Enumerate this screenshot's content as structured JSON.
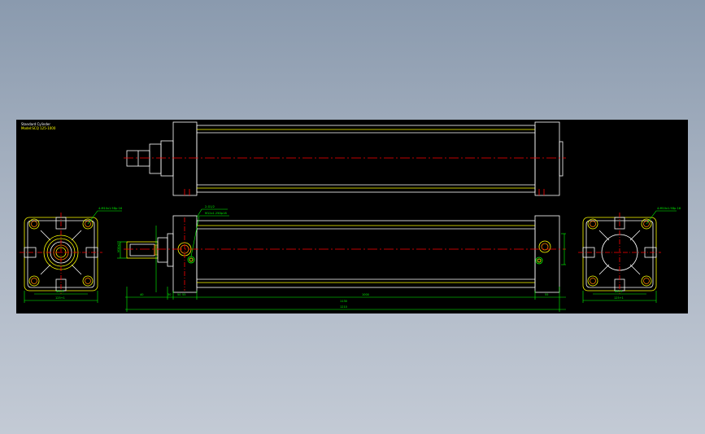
{
  "title_block": {
    "line1": "Standard Cylinder",
    "line2": "Model:SCQ 125-1000"
  },
  "annotations": {
    "left_leader": "4-M10x1.5Dp 16",
    "right_leader": "4-M10x1.5Dp 16",
    "port_note_1": "2-G1/2",
    "port_note_2": "M12x1.25Dp18",
    "rod_dim": "M30x2",
    "left_width_1": "Φ105",
    "left_width_2": "125+1",
    "right_width_1": "Φ105",
    "right_width_2": "125+1"
  },
  "dimensions": {
    "d1": "40",
    "d2": "30",
    "d3": "50",
    "d4": "55",
    "stroke": "1000",
    "body": "1130",
    "total": "1210",
    "right": "55"
  },
  "colors": {
    "viewport_bg": "#000000",
    "outline": "#ffffff",
    "part": "#ffff00",
    "centerline": "#ff0000",
    "dimension": "#00ff00",
    "port": "#ff8000"
  }
}
